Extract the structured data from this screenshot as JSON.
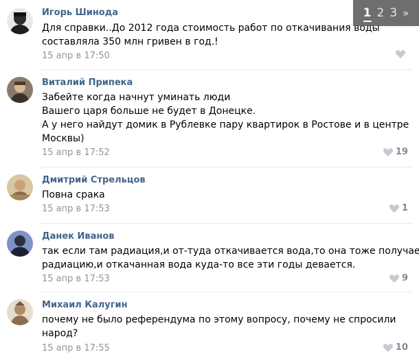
{
  "pagination": {
    "current": "1",
    "pages": [
      "2",
      "3"
    ],
    "next": "»"
  },
  "comments": [
    {
      "author": "Игорь Шинода",
      "lines": [
        "Для справки..До 2012 года стоимость работ по откачивания воды",
        "составляла 350 млн гривен в год.!"
      ],
      "date": "15 апр в 17:50",
      "likes": "",
      "avatar_color": "#2b2b2b"
    },
    {
      "author": "Виталий Припека",
      "lines": [
        "Забейте когда начнут уминать люди",
        "Вашего царя больше не будет в Донецке.",
        "А у него найдут домик в Рублевке пару квартирок в Ростове и в центре",
        "Москвы)"
      ],
      "date": "15 апр в 17:52",
      "likes": "19",
      "avatar_color": "#6b5a4a"
    },
    {
      "author": "Дмитрий Стрельцов",
      "lines": [
        "Повна срака"
      ],
      "date": "15 апр в 17:53",
      "likes": "1",
      "avatar_color": "#c9b48a"
    },
    {
      "author": "Данек Иванов",
      "lines": [
        "так если там радиация,и от-туда откачивается вода,то она тоже получает",
        "радиацию,и откачанная вода куда-то все эти годы девается."
      ],
      "date": "15 апр в 17:53",
      "likes": "9",
      "avatar_color": "#4a5f8c"
    },
    {
      "author": "Михаил Калугин",
      "lines": [
        "почему не было референдума по этому вопросу, почему не спросили",
        "народ?"
      ],
      "date": "15 апр в 17:55",
      "likes": "10",
      "avatar_color": "#a89070"
    }
  ],
  "colors": {
    "author": "#42648b",
    "date": "#939393",
    "likes": "#828a99",
    "divider": "#e7e8ec"
  }
}
